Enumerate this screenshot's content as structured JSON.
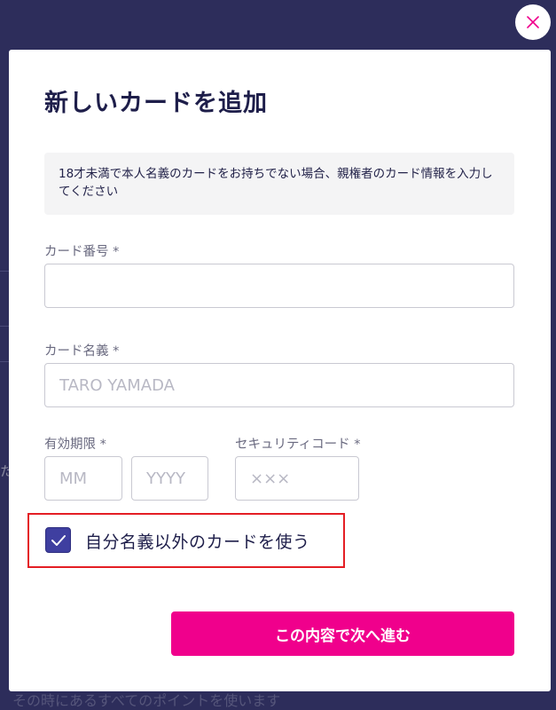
{
  "modal": {
    "title": "新しいカードを追加",
    "notice": "18才未満で本人名義のカードをお持ちでない場合、親権者のカード情報を入力してください",
    "card_number": {
      "label": "カード番号 *",
      "value": "",
      "placeholder": ""
    },
    "card_holder": {
      "label": "カード名義 *",
      "value": "",
      "placeholder": "TARO YAMADA"
    },
    "expiry": {
      "label": "有効期限 *",
      "month_placeholder": "MM",
      "year_placeholder": "YYYY"
    },
    "security_code": {
      "label": "セキュリティコード *",
      "placeholder": "×××"
    },
    "use_other_name": {
      "label": "自分名義以外のカードを使う",
      "checked": true
    },
    "submit_label": "この内容で次へ進む"
  },
  "background": {
    "left_fragment": "た",
    "bottom_fragment": "その時にあるすべてのポイントを使います"
  },
  "colors": {
    "accent": "#f0008c",
    "checkbox": "#3f3fa0",
    "overlay": "#2d2d5b",
    "highlight_border": "#e41e24"
  }
}
